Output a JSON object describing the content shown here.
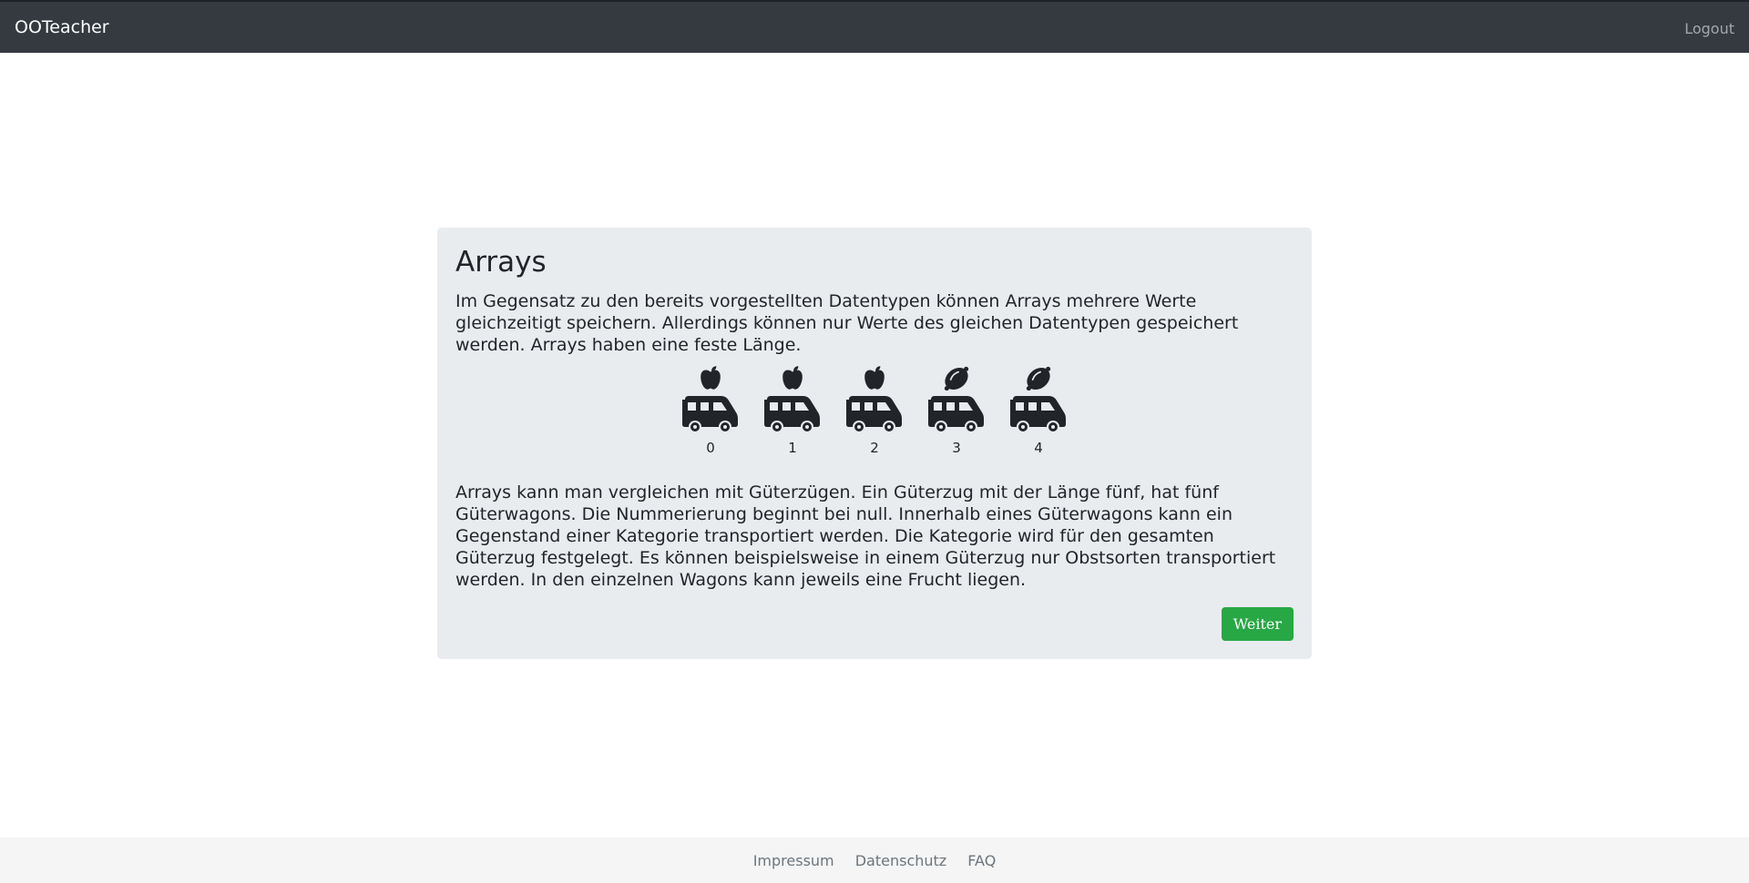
{
  "navbar": {
    "brand": "OOTeacher",
    "logout": "Logout"
  },
  "card": {
    "title": "Arrays",
    "intro": "Im Gegensatz zu den bereits vorgestellten Datentypen können Arrays mehrere Werte gleichzeitigt speichern. Allerdings können nur Werte des gleichen Datentypen gespeichert werden. Arrays haben eine feste Länge.",
    "wagons": [
      {
        "index": "0",
        "fruit_icon": "apple-icon"
      },
      {
        "index": "1",
        "fruit_icon": "apple-icon"
      },
      {
        "index": "2",
        "fruit_icon": "apple-icon"
      },
      {
        "index": "3",
        "fruit_icon": "lemon-icon"
      },
      {
        "index": "4",
        "fruit_icon": "lemon-icon"
      }
    ],
    "explanation": "Arrays kann man vergleichen mit Güterzügen. Ein Güterzug mit der Länge fünf, hat fünf Güterwagons. Die Nummerierung beginnt bei null. Innerhalb eines Güterwagons kann ein Gegenstand einer Kategorie transportiert werden. Die Kategorie wird für den gesamten Güterzug festgelegt. Es können beispielsweise in einem Güterzug nur Obstsorten transportiert werden. In den einzelnen Wagons kann jeweils eine Frucht liegen.",
    "next_button": "Weiter"
  },
  "footer": {
    "links": [
      "Impressum",
      "Datenschutz",
      "FAQ"
    ]
  },
  "colors": {
    "navbar": "#343a40",
    "card": "#e9ecef",
    "button": "#28a745",
    "footer": "#f5f5f5"
  }
}
